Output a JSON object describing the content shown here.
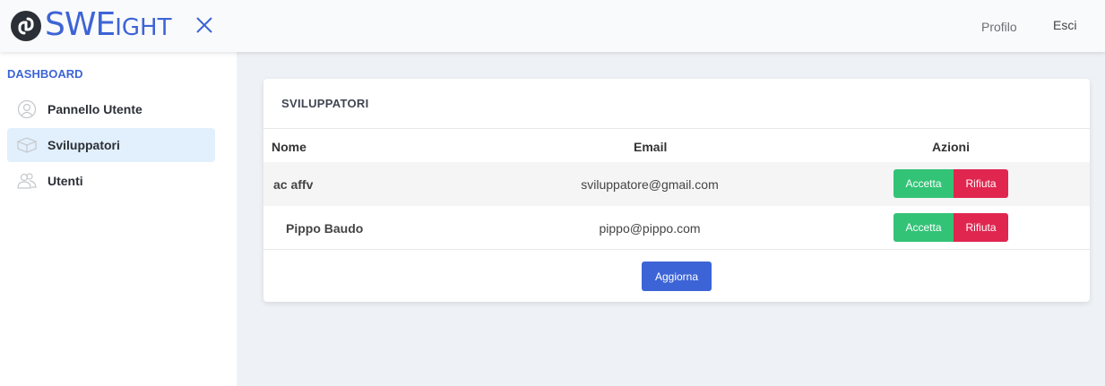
{
  "header": {
    "logo_text_big": "SWE",
    "logo_text_small": "IGHT",
    "profile_link": "Profilo",
    "logout_link": "Esci"
  },
  "sidebar": {
    "title": "DASHBOARD",
    "items": [
      {
        "label": "Pannello Utente",
        "icon": "user-circle-icon",
        "active": false
      },
      {
        "label": "Sviluppatori",
        "icon": "box-icon",
        "active": true
      },
      {
        "label": "Utenti",
        "icon": "users-icon",
        "active": false
      }
    ]
  },
  "card": {
    "title": "SVILUPPATORI",
    "columns": [
      "Nome",
      "Email",
      "Azioni"
    ],
    "rows": [
      {
        "name": "ac affv",
        "email": "sviluppatore@gmail.com",
        "accept": "Accetta",
        "reject": "Rifiuta"
      },
      {
        "name": "Pippo Baudo",
        "email": "pippo@pippo.com",
        "accept": "Accetta",
        "reject": "Rifiuta"
      }
    ],
    "refresh_label": "Aggiorna"
  },
  "colors": {
    "brand": "#3d64d6",
    "accept": "#33c377",
    "reject": "#e0264f",
    "active_item": "#e2effc"
  }
}
